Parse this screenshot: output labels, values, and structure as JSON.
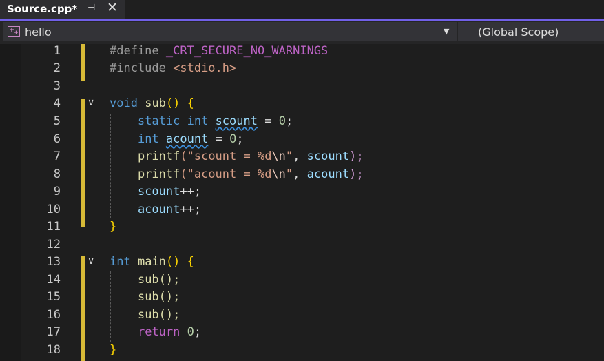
{
  "tab": {
    "title": "Source.cpp*",
    "pin_icon": "pin-icon",
    "close_icon": "close-icon"
  },
  "navbar": {
    "project": "hello",
    "scope": "(Global Scope)"
  },
  "line_numbers": [
    "1",
    "2",
    "3",
    "4",
    "5",
    "6",
    "7",
    "8",
    "9",
    "10",
    "11",
    "12",
    "13",
    "14",
    "15",
    "16",
    "17",
    "18"
  ],
  "code": {
    "l1_a": "#define ",
    "l1_b": "_CRT_SECURE_NO_WARNINGS",
    "l2_a": "#include ",
    "l2_b": "<stdio.h>",
    "l4_kw": "void",
    "l4_fn": "sub",
    "l4_rest": "() {",
    "l5_kw": "static int",
    "l5_var": "scount",
    "l5_eq": " = ",
    "l5_num": "0",
    "l5_end": ";",
    "l6_kw": "int",
    "l6_var": "acount",
    "l6_eq": " = ",
    "l6_num": "0",
    "l6_end": ";",
    "l7_fn": "printf",
    "l7_str1": "(\"scount = %d",
    "l7_esc": "\\n",
    "l7_str2": "\"",
    "l7_var": "scount",
    "l7_end": ");",
    "l8_fn": "printf",
    "l8_str1": "(\"acount = %d",
    "l8_esc": "\\n",
    "l8_str2": "\"",
    "l8_var": "acount",
    "l8_end": ");",
    "l9_var": "scount",
    "l9_end": "++;",
    "l10_var": "acount",
    "l10_end": "++;",
    "l11": "}",
    "l13_kw": "int",
    "l13_fn": "main",
    "l13_rest": "() {",
    "l14": "sub();",
    "l15": "sub();",
    "l16": "sub();",
    "l17_kw": "return",
    "l17_num": "0",
    "l17_end": ";",
    "l18": "}"
  },
  "colors": {
    "accent": "#7160e8",
    "background": "#1e1e1e",
    "change_margin": "#d7ba37"
  }
}
